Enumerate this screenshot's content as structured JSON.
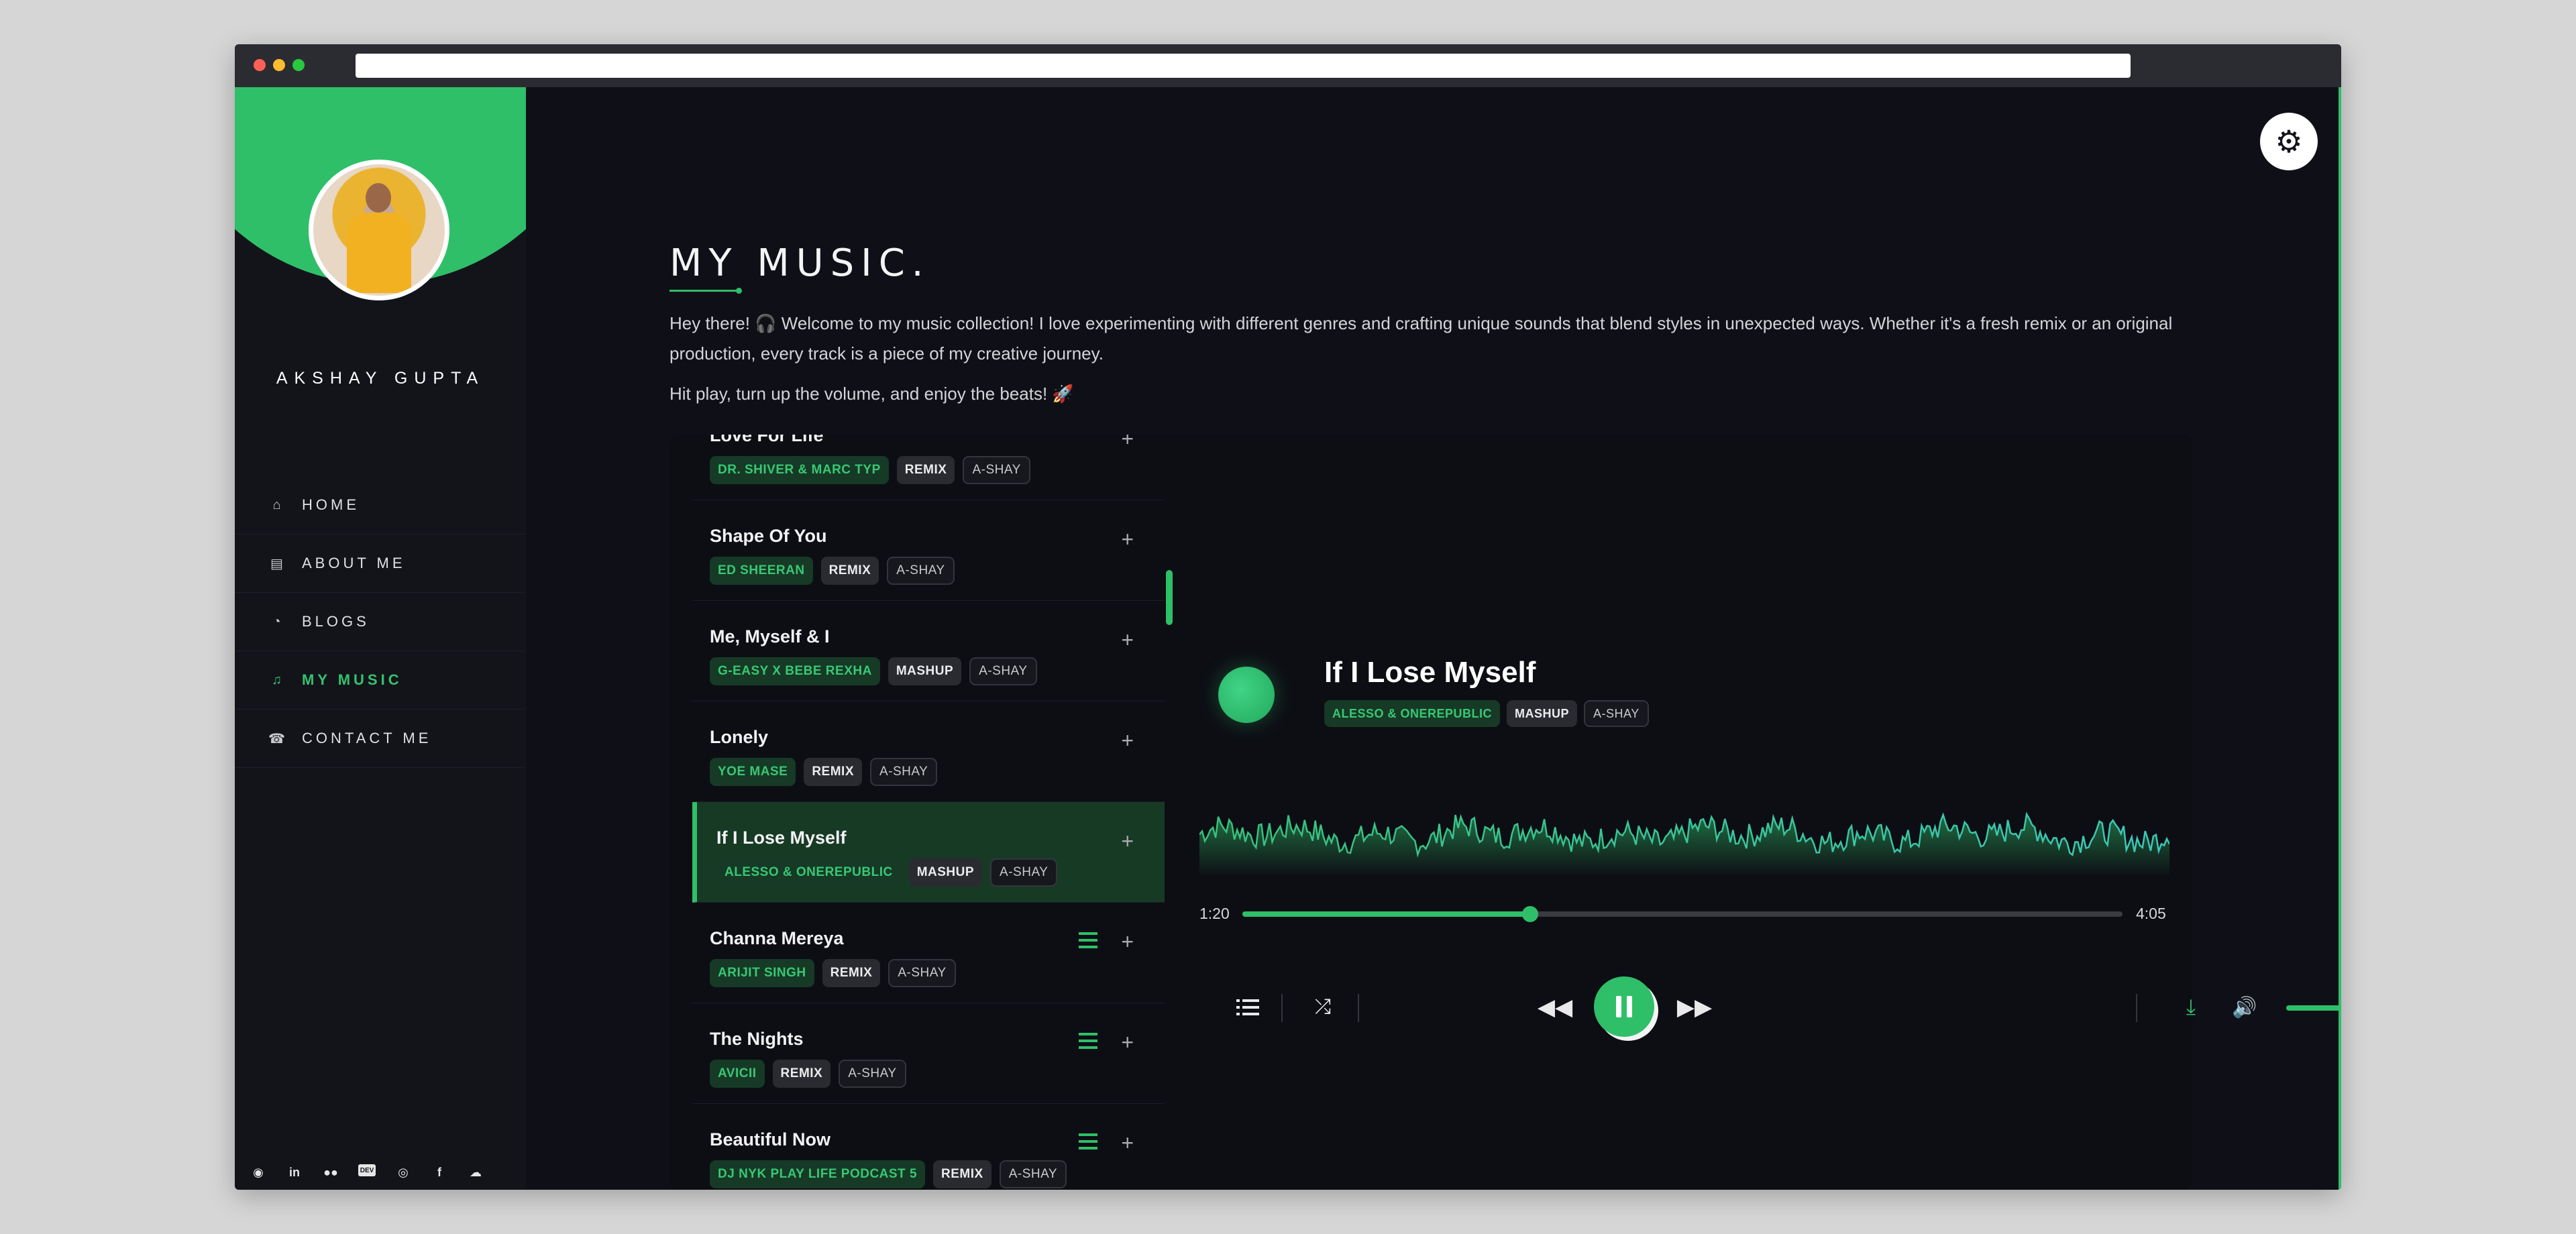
{
  "profile": {
    "name": "AKSHAY GUPTA"
  },
  "nav": [
    {
      "label": "HOME",
      "icon": "home-icon",
      "active": false
    },
    {
      "label": "ABOUT ME",
      "icon": "id-badge-icon",
      "active": false
    },
    {
      "label": "BLOGS",
      "icon": "rss-icon",
      "active": false
    },
    {
      "label": "MY MUSIC",
      "icon": "music-note-icon",
      "active": true
    },
    {
      "label": "CONTACT ME",
      "icon": "contact-icon",
      "active": false
    }
  ],
  "socials": [
    "github-icon",
    "linkedin-icon",
    "medium-icon",
    "devto-icon",
    "instagram-icon",
    "facebook-icon",
    "soundcloud-icon"
  ],
  "page": {
    "title": "MY MUSIC.",
    "intro": "Hey there! 🎧 Welcome to my music collection! I love experimenting with different genres and crafting unique sounds that blend styles in unexpected ways. Whether it's a fresh remix or an original production, every track is a piece of my creative journey.",
    "intro2": "Hit play, turn up the volume, and enjoy the beats! 🚀"
  },
  "tracks": [
    {
      "title": "Love For Life",
      "artist": "DR. SHIVER & MARC TYP",
      "kind": "REMIX",
      "owner": "A-SHAY",
      "queued": false,
      "active": false
    },
    {
      "title": "Shape Of You",
      "artist": "ED SHEERAN",
      "kind": "REMIX",
      "owner": "A-SHAY",
      "queued": false,
      "active": false
    },
    {
      "title": "Me, Myself & I",
      "artist": "G-EASY X BEBE REXHA",
      "kind": "MASHUP",
      "owner": "A-SHAY",
      "queued": false,
      "active": false
    },
    {
      "title": "Lonely",
      "artist": "YOE MASE",
      "kind": "REMIX",
      "owner": "A-SHAY",
      "queued": false,
      "active": false
    },
    {
      "title": "If I Lose Myself",
      "artist": "ALESSO & ONEREPUBLIC",
      "kind": "MASHUP",
      "owner": "A-SHAY",
      "queued": false,
      "active": true
    },
    {
      "title": "Channa Mereya",
      "artist": "ARIJIT SINGH",
      "kind": "REMIX",
      "owner": "A-SHAY",
      "queued": true,
      "active": false
    },
    {
      "title": "The Nights",
      "artist": "AVICII",
      "kind": "REMIX",
      "owner": "A-SHAY",
      "queued": true,
      "active": false
    },
    {
      "title": "Beautiful Now",
      "artist": "DJ NYK PLAY LIFE PODCAST 5",
      "kind": "REMIX",
      "owner": "A-SHAY",
      "queued": true,
      "active": false
    }
  ],
  "now_playing": {
    "title": "If I Lose Myself",
    "artist": "ALESSO & ONEREPUBLIC",
    "kind": "MASHUP",
    "owner": "A-SHAY",
    "current_time": "1:20",
    "total_time": "4:05",
    "progress": 0.327,
    "volume": 0.8
  },
  "colors": {
    "accent": "#2fbf69",
    "background": "#0f1017",
    "sidebar": "#13141a"
  }
}
